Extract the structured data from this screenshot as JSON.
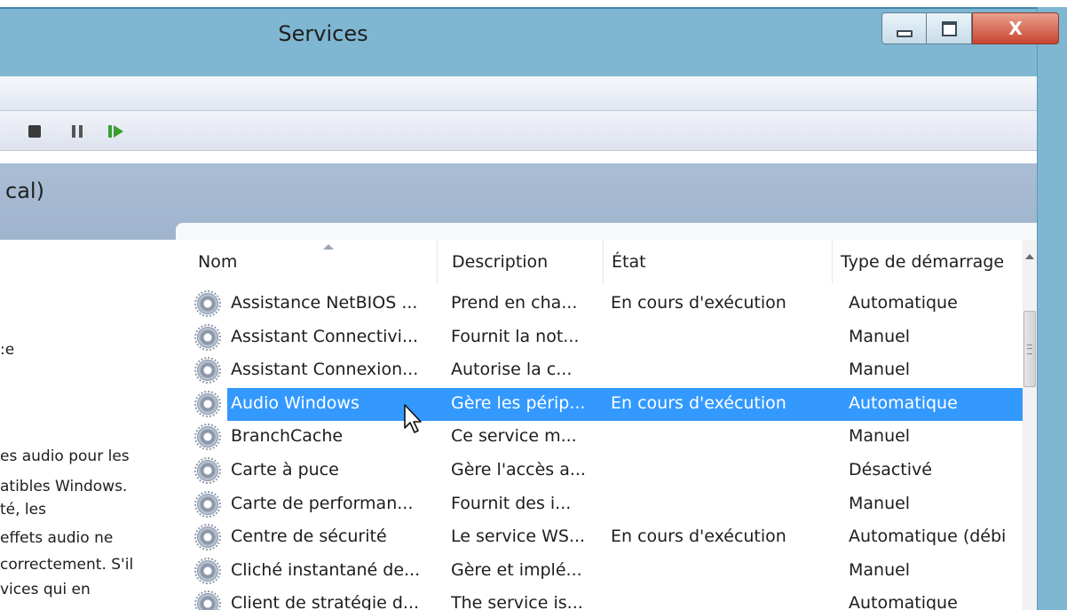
{
  "window": {
    "title": "Services",
    "controls": {
      "minimize": "minimize",
      "maximize": "maximize",
      "close": "X"
    }
  },
  "toolbar": {
    "buttons": [
      {
        "icon": "stop-icon"
      },
      {
        "icon": "pause-icon"
      },
      {
        "icon": "restart-icon"
      }
    ]
  },
  "header": {
    "title": "cal)"
  },
  "left_pane": {
    "lines": [
      ":e",
      "es audio pour les",
      "atibles Windows.",
      "té, les",
      "effets audio ne",
      "correctement. S'il",
      "vices qui en"
    ]
  },
  "table": {
    "columns": [
      "Nom",
      "Description",
      "État",
      "Type de démarrage"
    ],
    "rows": [
      {
        "name": "Assistance NetBIOS ...",
        "description": "Prend en cha...",
        "state": "En cours d'exécution",
        "startup": "Automatique",
        "selected": false
      },
      {
        "name": "Assistant Connectivi...",
        "description": "Fournit la not...",
        "state": "",
        "startup": "Manuel",
        "selected": false
      },
      {
        "name": "Assistant Connexion...",
        "description": "Autorise la c...",
        "state": "",
        "startup": "Manuel",
        "selected": false
      },
      {
        "name": "Audio Windows",
        "description": "Gère les périp...",
        "state": "En cours d'exécution",
        "startup": "Automatique",
        "selected": true
      },
      {
        "name": "BranchCache",
        "description": "Ce service m...",
        "state": "",
        "startup": "Manuel",
        "selected": false
      },
      {
        "name": "Carte à puce",
        "description": "Gère l'accès a...",
        "state": "",
        "startup": "Désactivé",
        "selected": false
      },
      {
        "name": "Carte de performan...",
        "description": "Fournit des i...",
        "state": "",
        "startup": "Manuel",
        "selected": false
      },
      {
        "name": "Centre de sécurité",
        "description": "Le service WS...",
        "state": "En cours d'exécution",
        "startup": "Automatique (débi",
        "selected": false
      },
      {
        "name": "Cliché instantané de...",
        "description": "Gère et implé...",
        "state": "",
        "startup": "Manuel",
        "selected": false
      },
      {
        "name": "Client de stratégie d...",
        "description": "The service is...",
        "state": "",
        "startup": "Automatique",
        "selected": false
      }
    ]
  }
}
